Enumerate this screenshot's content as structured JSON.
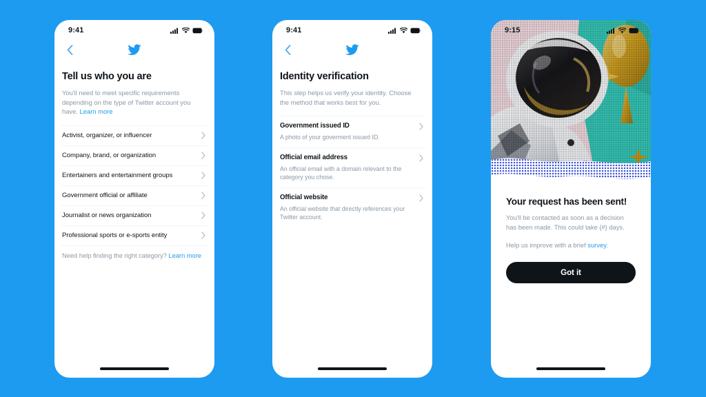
{
  "canvas": {
    "background_color": "#1D9BF0",
    "accent_color": "#1D9BF0",
    "text_primary_color": "#0F1419",
    "text_muted_color": "#8B98A5",
    "cta_color": "#0F1419"
  },
  "screens": [
    {
      "id": "tell-us-who-you-are",
      "status_bar": {
        "time": "9:41",
        "icons": [
          "cellular-signal-icon",
          "wifi-icon",
          "battery-icon"
        ]
      },
      "nav": {
        "back_icon": "chevron-left-icon",
        "logo_icon": "twitter-bird-icon"
      },
      "title": "Tell us who you are",
      "subtitle_text": "You'll need to meet specific requirements depending on the type of Twitter account you have. ",
      "subtitle_link": "Learn more",
      "categories": [
        "Activist, organizer, or influencer",
        "Company, brand, or organization",
        "Entertainers and entertainment groups",
        "Government official or affiliate",
        "Journalist or news organization",
        "Professional sports or e-sports entity"
      ],
      "footer_text": "Need help finding the right category? ",
      "footer_link": "Learn more"
    },
    {
      "id": "identity-verification",
      "status_bar": {
        "time": "9:41",
        "icons": [
          "cellular-signal-icon",
          "wifi-icon",
          "battery-icon"
        ]
      },
      "nav": {
        "back_icon": "chevron-left-icon",
        "logo_icon": "twitter-bird-icon"
      },
      "title": "Identity verification",
      "subtitle_text": "This step helps us verify your identity. Choose the method that works best for you.",
      "methods": [
        {
          "title": "Government issued ID",
          "description": "A photo of your goverment issued ID."
        },
        {
          "title": "Official email address",
          "description": "An official email with a domain relevant to the category you chose."
        },
        {
          "title": "Official website",
          "description": "An official website that directly references your Twitter account."
        }
      ]
    },
    {
      "id": "request-sent",
      "status_bar": {
        "time": "9:15",
        "icons": [
          "cellular-signal-icon",
          "wifi-icon",
          "battery-icon"
        ]
      },
      "hero": {
        "alt": "halftone-astronaut-illustration",
        "palette": {
          "pink": "#f3d7dd",
          "teal": "#35c8b8",
          "gold": "#d4a017",
          "dot_blue": "#3a52d8",
          "dark": "#1a1a1a"
        }
      },
      "title": "Your request has been sent!",
      "subtitle": "You'll be contacted as soon as a decision has been made. This could take {#} days.",
      "survey_text": "Help us improve with a brief ",
      "survey_link": "survey",
      "survey_tail": ".",
      "cta_label": "Got it"
    }
  ]
}
